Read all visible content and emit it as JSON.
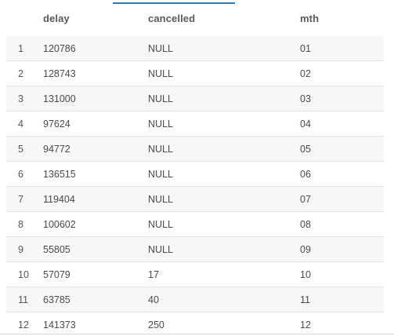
{
  "table": {
    "columns": [
      "delay",
      "cancelled",
      "mth"
    ],
    "rows": [
      {
        "index": "1",
        "delay": "120786",
        "cancelled": "NULL",
        "mth": "01"
      },
      {
        "index": "2",
        "delay": "128743",
        "cancelled": "NULL",
        "mth": "02"
      },
      {
        "index": "3",
        "delay": "131000",
        "cancelled": "NULL",
        "mth": "03"
      },
      {
        "index": "4",
        "delay": "97624",
        "cancelled": "NULL",
        "mth": "04"
      },
      {
        "index": "5",
        "delay": "94772",
        "cancelled": "NULL",
        "mth": "05"
      },
      {
        "index": "6",
        "delay": "136515",
        "cancelled": "NULL",
        "mth": "06"
      },
      {
        "index": "7",
        "delay": "119404",
        "cancelled": "NULL",
        "mth": "07"
      },
      {
        "index": "8",
        "delay": "100602",
        "cancelled": "NULL",
        "mth": "08"
      },
      {
        "index": "9",
        "delay": "55805",
        "cancelled": "NULL",
        "mth": "09"
      },
      {
        "index": "10",
        "delay": "57079",
        "cancelled": "17",
        "mth": "10"
      },
      {
        "index": "11",
        "delay": "63785",
        "cancelled": "40",
        "mth": "11"
      },
      {
        "index": "12",
        "delay": "141373",
        "cancelled": "250",
        "mth": "12"
      }
    ]
  },
  "colors": {
    "accent": "#2a7ab8",
    "row_alt": "#f7f7f7",
    "row_border": "#e3e3e3"
  }
}
